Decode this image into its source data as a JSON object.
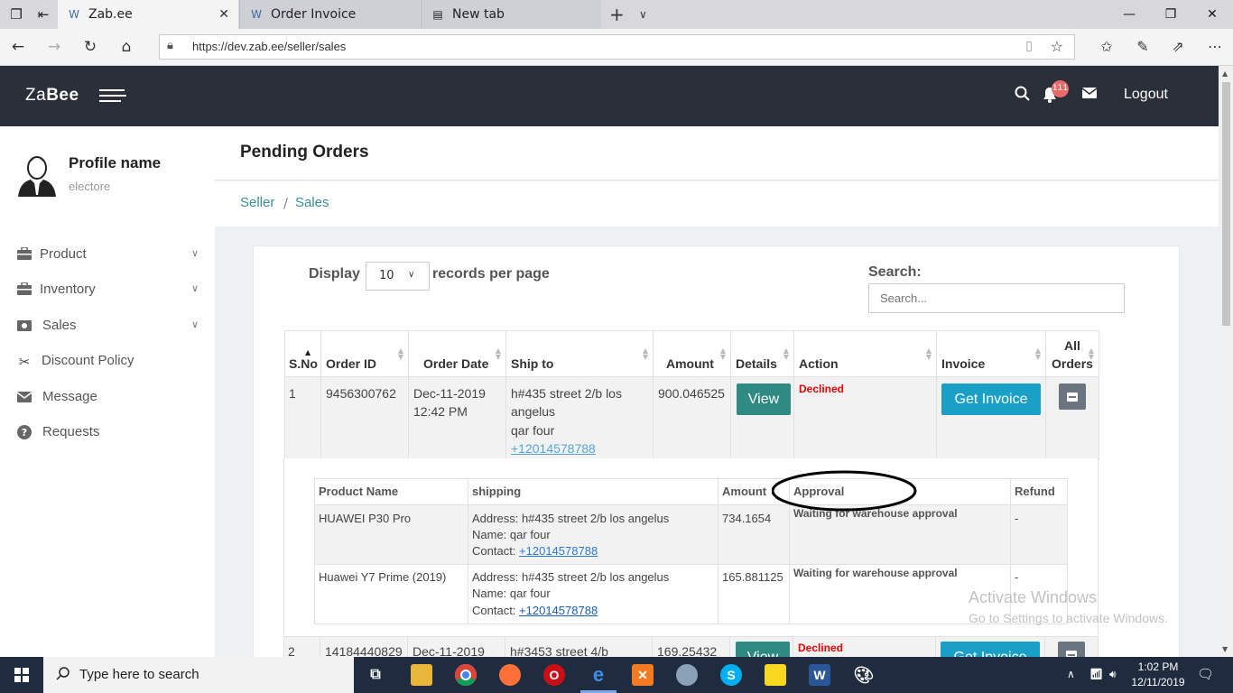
{
  "browser": {
    "tabs": [
      {
        "title": "Zab.ee",
        "active": true
      },
      {
        "title": "Order Invoice",
        "active": false
      },
      {
        "title": "New tab",
        "active": false
      }
    ],
    "url": "https://dev.zab.ee/seller/sales"
  },
  "header": {
    "logo_light": "Za",
    "logo_bold": "Bee",
    "notification_count": "111",
    "logout_label": "Logout"
  },
  "sidebar": {
    "profile_name": "Profile name",
    "profile_user": "electore",
    "items": [
      {
        "label": "Product",
        "icon": "briefcase-icon",
        "has_submenu": true
      },
      {
        "label": "Inventory",
        "icon": "briefcase-icon",
        "has_submenu": true
      },
      {
        "label": "Sales",
        "icon": "money-icon",
        "has_submenu": true
      },
      {
        "label": "Discount Policy",
        "icon": "scissors-icon",
        "has_submenu": false
      },
      {
        "label": "Message",
        "icon": "envelope-icon",
        "has_submenu": false
      },
      {
        "label": "Requests",
        "icon": "question-icon",
        "has_submenu": false
      }
    ]
  },
  "page": {
    "title": "Pending Orders",
    "breadcrumb": [
      "Seller",
      "Sales"
    ]
  },
  "table_controls": {
    "display_label": "Display",
    "page_size": "10",
    "records_label": "records per page",
    "search_label": "Search:",
    "search_placeholder": "Search..."
  },
  "orders": {
    "headers": [
      "S.No",
      "Order ID",
      "Order Date",
      "Ship to",
      "Amount",
      "Details",
      "Action",
      "Invoice",
      "All Orders"
    ],
    "view_label": "View",
    "invoice_label": "Get Invoice",
    "rows": [
      {
        "sno": "1",
        "order_id": "9456300762",
        "date_line1": "Dec-11-2019",
        "date_line2": "12:42 PM",
        "ship_line1": "h#435 street 2/b los",
        "ship_line2": "angelus",
        "ship_name": "qar four",
        "ship_phone": "+12014578788",
        "amount": "900.046525",
        "action": "Declined"
      },
      {
        "sno": "2",
        "order_id": "14184440829",
        "date_line1": "Dec-11-2019",
        "ship_line1": "h#3453 street 4/b",
        "amount": "169.25432",
        "action": "Declined"
      }
    ]
  },
  "products": {
    "headers": [
      "Product Name",
      "shipping",
      "Amount",
      "Approval",
      "Refund"
    ],
    "address_label": "Address:",
    "name_label": "Name:",
    "contact_label": "Contact:",
    "rows": [
      {
        "name": "HUAWEI P30 Pro",
        "address": "h#435 street 2/b los angelus",
        "ship_name": "qar four",
        "contact": "+12014578788",
        "amount": "734.1654",
        "approval": "Waiting for warehouse approval",
        "refund": "-"
      },
      {
        "name": "Huawei Y7 Prime (2019)",
        "address": "h#435 street 2/b los angelus",
        "ship_name": "qar four",
        "contact": "+12014578788",
        "amount": "165.881125",
        "approval": "Waiting for warehouse approval",
        "refund": "-"
      }
    ]
  },
  "watermark": {
    "line1": "Activate Windows",
    "line2": "Go to Settings to activate Windows."
  },
  "taskbar": {
    "search_placeholder": "Type here to search",
    "time": "1:02 PM",
    "date": "12/11/2019"
  },
  "colors": {
    "header_bg": "#2b2f3a",
    "accent_teal": "#2f8a84",
    "invoice_blue": "#1aa0c6",
    "declined_red": "#e00000",
    "badge_red": "#e96a6a"
  }
}
